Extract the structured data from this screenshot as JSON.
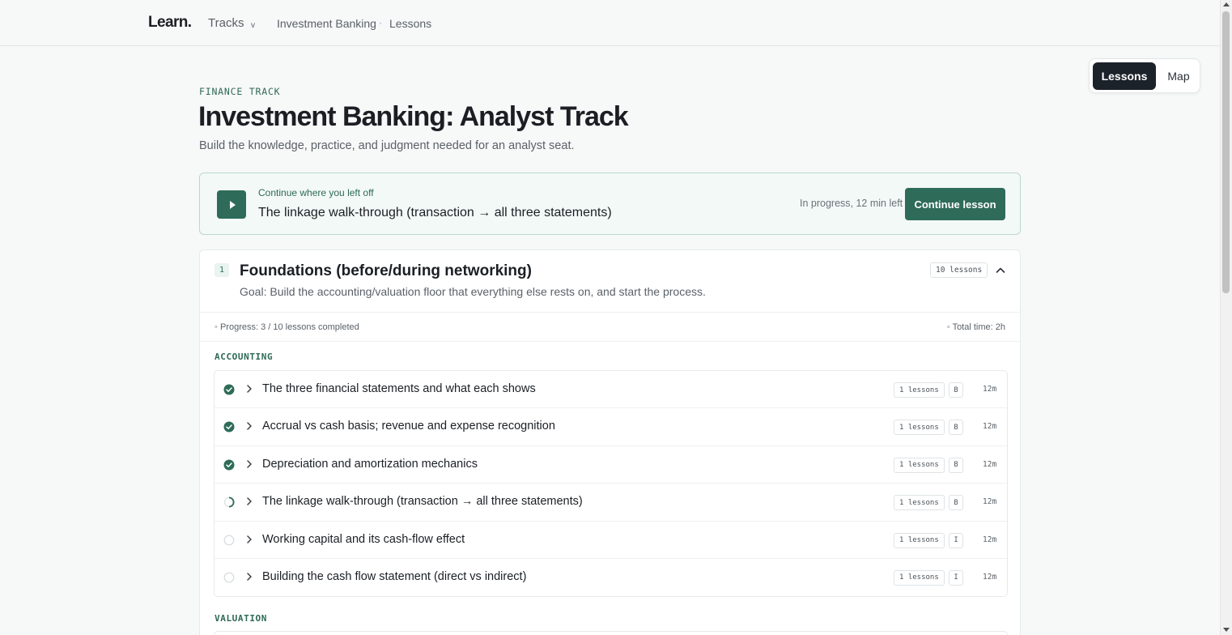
{
  "nav": {
    "logo": "Learn.",
    "tracks": "Tracks",
    "tracks_chevron": "v",
    "breadcrumb": [
      "Investment Banking",
      "Lessons"
    ],
    "breadcrumb_sep": "·"
  },
  "view_toggle": {
    "lessons": "Lessons",
    "map": "Map",
    "active": "Lessons"
  },
  "header": {
    "eyebrow": "FINANCE TRACK",
    "title": "Investment Banking: Analyst Track",
    "subtitle": "Build the knowledge, practice, and judgment needed for an analyst seat."
  },
  "continue_card": {
    "label": "Continue where you left off",
    "lesson_title": "The linkage walk-through (transaction → all three statements)",
    "status": "In progress, 12 min left",
    "button": "Continue lesson"
  },
  "section": {
    "number": "1",
    "title": "Foundations (before/during networking)",
    "goal": "Goal: Build the accounting/valuation floor that everything else rests on, and start the process.",
    "lesson_count": "10 lessons",
    "progress": "◦ Progress: 3 / 10 lessons completed",
    "total_time": "◦ Total time: 2h",
    "progress_fraction": 0.3,
    "groups": [
      {
        "label": "ACCOUNTING",
        "lessons": [
          {
            "status": "completed",
            "title": "The three financial statements and what each shows",
            "count": "1 lessons",
            "level": "B",
            "time": "12m"
          },
          {
            "status": "completed",
            "title": "Accrual vs cash basis; revenue and expense recognition",
            "count": "1 lessons",
            "level": "B",
            "time": "12m"
          },
          {
            "status": "completed",
            "title": "Depreciation and amortization mechanics",
            "count": "1 lessons",
            "level": "B",
            "time": "12m"
          },
          {
            "status": "in-progress",
            "title": "The linkage walk-through (transaction → all three statements)",
            "count": "1 lessons",
            "level": "B",
            "time": "12m"
          },
          {
            "status": "not-started",
            "title": "Working capital and its cash-flow effect",
            "count": "1 lessons",
            "level": "I",
            "time": "12m"
          },
          {
            "status": "not-started",
            "title": "Building the cash flow statement (direct vs indirect)",
            "count": "1 lessons",
            "level": "I",
            "time": "12m"
          }
        ]
      },
      {
        "label": "VALUATION",
        "lessons": []
      }
    ]
  },
  "colors": {
    "accent": "#2e6b58",
    "accent_text": "#2e6a55",
    "toggle_active": "#1c222a",
    "continue_bg": "#f3f9f7"
  },
  "icons": {
    "play": "play-icon",
    "collapse": "chevron-up-icon",
    "row_expand": "chevron-right-icon",
    "completed": "check-circle-icon",
    "in_progress": "partial-circle-icon",
    "not_started": "empty-circle-icon"
  }
}
